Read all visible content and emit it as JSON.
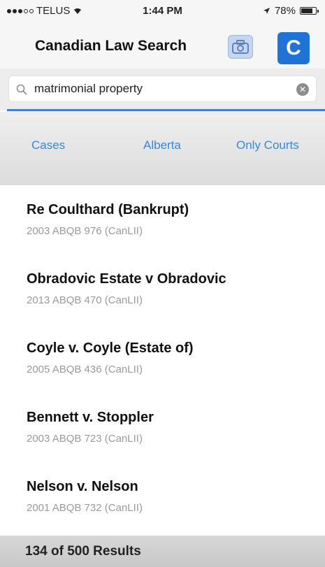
{
  "status_bar": {
    "carrier": "TELUS",
    "time": "1:44 PM",
    "battery": "78%",
    "battery_level": 0.78
  },
  "nav": {
    "title": "Canadian Law Search",
    "camera_icon": "camera-icon",
    "logo_icon": "canlii-logo-icon",
    "logo_glyph": "C"
  },
  "search": {
    "value": "matrimonial property",
    "placeholder": ""
  },
  "filters": [
    {
      "label": "Cases"
    },
    {
      "label": "Alberta"
    },
    {
      "label": "Only Courts"
    }
  ],
  "results": [
    {
      "title": "Re Coulthard (Bankrupt)",
      "citation": "2003 ABQB 976 (CanLII)"
    },
    {
      "title": "Obradovic Estate v Obradovic",
      "citation": "2013 ABQB 470 (CanLII)"
    },
    {
      "title": "Coyle v. Coyle (Estate of)",
      "citation": "2005 ABQB 436 (CanLII)"
    },
    {
      "title": "Bennett v. Stoppler",
      "citation": "2003 ABQB 723 (CanLII)"
    },
    {
      "title": "Nelson v. Nelson",
      "citation": "2001 ABQB 732 (CanLII)"
    }
  ],
  "footer": {
    "count_text": "134 of 500 Results"
  },
  "colors": {
    "accent": "#3a86d8",
    "logo_bg": "#1f73d6"
  }
}
